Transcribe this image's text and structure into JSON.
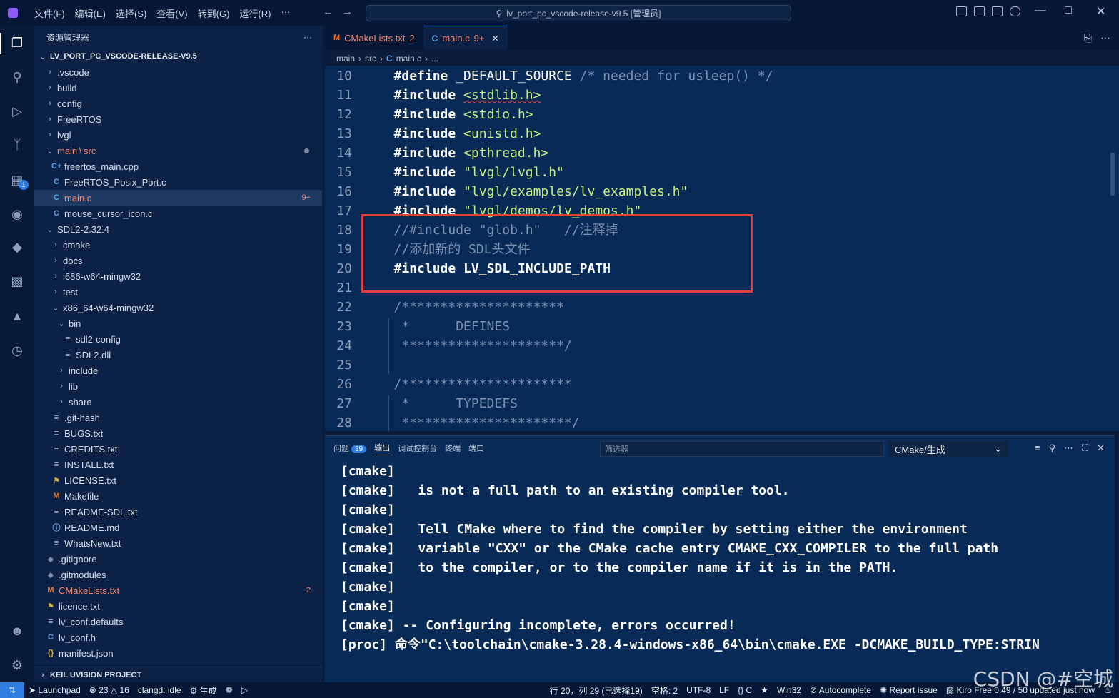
{
  "titlebar": {
    "menu": [
      "文件(F)",
      "编辑(E)",
      "选择(S)",
      "查看(V)",
      "转到(G)",
      "运行(R)",
      "···"
    ],
    "search": "lv_port_pc_vscode-release-v9.5 [管理员]"
  },
  "activity": {
    "extensions_badge": "1"
  },
  "sidebar": {
    "title": "资源管理器",
    "more": "···",
    "project": "LV_PORT_PC_VSCODE-RELEASE-V9.5",
    "items": [
      {
        "label": ".vscode",
        "type": "folder"
      },
      {
        "label": "build",
        "type": "folder"
      },
      {
        "label": "config",
        "type": "folder"
      },
      {
        "label": "FreeRTOS",
        "type": "folder"
      },
      {
        "label": "lvgl",
        "type": "folder"
      },
      {
        "label": "main",
        "label2": "src",
        "type": "folder-open"
      },
      {
        "label": "freertos_main.cpp",
        "icon": "C+"
      },
      {
        "label": "FreeRTOS_Posix_Port.c",
        "icon": "C"
      },
      {
        "label": "main.c",
        "icon": "C",
        "count": "9+"
      },
      {
        "label": "mouse_cursor_icon.c",
        "icon": "C"
      },
      {
        "label": "SDL2-2.32.4",
        "type": "folder-open"
      },
      {
        "label": "cmake",
        "type": "folder"
      },
      {
        "label": "docs",
        "type": "folder"
      },
      {
        "label": "i686-w64-mingw32",
        "type": "folder"
      },
      {
        "label": "test",
        "type": "folder"
      },
      {
        "label": "x86_64-w64-mingw32",
        "type": "folder-open"
      },
      {
        "label": "bin",
        "type": "folder-open"
      },
      {
        "label": "sdl2-config",
        "icon": "≡"
      },
      {
        "label": "SDL2.dll",
        "icon": "≡"
      },
      {
        "label": "include",
        "type": "folder"
      },
      {
        "label": "lib",
        "type": "folder"
      },
      {
        "label": "share",
        "type": "folder"
      },
      {
        "label": ".git-hash",
        "icon": "≡"
      },
      {
        "label": "BUGS.txt",
        "icon": "≡"
      },
      {
        "label": "CREDITS.txt",
        "icon": "≡"
      },
      {
        "label": "INSTALL.txt",
        "icon": "≡"
      },
      {
        "label": "LICENSE.txt",
        "icon": "🎗"
      },
      {
        "label": "Makefile",
        "icon": "M"
      },
      {
        "label": "README-SDL.txt",
        "icon": "≡"
      },
      {
        "label": "README.md",
        "icon": "ⓘ"
      },
      {
        "label": "WhatsNew.txt",
        "icon": "≡"
      },
      {
        "label": ".gitignore",
        "icon": "◆"
      },
      {
        "label": ".gitmodules",
        "icon": "◆"
      },
      {
        "label": "CMakeLists.txt",
        "icon": "M",
        "count": "2"
      },
      {
        "label": "licence.txt",
        "icon": "🎗"
      },
      {
        "label": "lv_conf.defaults",
        "icon": "≡"
      },
      {
        "label": "lv_conf.h",
        "icon": "C"
      },
      {
        "label": "manifest.json",
        "icon": "{}"
      }
    ],
    "bottom_section": "KEIL UVISION PROJECT"
  },
  "tabs": [
    {
      "icon": "M",
      "label": "CMakeLists.txt",
      "count": "2"
    },
    {
      "icon": "C",
      "label": "main.c",
      "count": "9+",
      "close": "✕"
    }
  ],
  "breadcrumb": [
    "main",
    "src",
    "main.c",
    "..."
  ],
  "code": [
    {
      "n": "10",
      "parts": [
        [
          "kw",
          "#define"
        ],
        [
          "ident",
          " _DEFAULT_SOURCE "
        ],
        [
          "cmt",
          "/* needed for usleep() */"
        ]
      ]
    },
    {
      "n": "11",
      "parts": [
        [
          "kw",
          "#include "
        ],
        [
          "str sq",
          "<stdlib.h>"
        ]
      ]
    },
    {
      "n": "12",
      "parts": [
        [
          "kw",
          "#include "
        ],
        [
          "str",
          "<stdio.h>"
        ]
      ]
    },
    {
      "n": "13",
      "parts": [
        [
          "kw",
          "#include "
        ],
        [
          "str",
          "<unistd.h>"
        ]
      ]
    },
    {
      "n": "14",
      "parts": [
        [
          "kw",
          "#include "
        ],
        [
          "str",
          "<pthread.h>"
        ]
      ]
    },
    {
      "n": "15",
      "parts": [
        [
          "kw",
          "#include "
        ],
        [
          "str",
          "\"lvgl/lvgl.h\""
        ]
      ]
    },
    {
      "n": "16",
      "parts": [
        [
          "kw",
          "#include "
        ],
        [
          "str",
          "\"lvgl/examples/lv_examples.h\""
        ]
      ]
    },
    {
      "n": "17",
      "parts": [
        [
          "kw",
          "#include "
        ],
        [
          "str",
          "\"lvgl/demos/lv_demos.h\""
        ]
      ]
    },
    {
      "n": "18",
      "parts": [
        [
          "cmt",
          "//#include \"glob.h\"   //注释掉"
        ]
      ]
    },
    {
      "n": "19",
      "parts": [
        [
          "cmt",
          "//添加新的 SDL头文件"
        ]
      ]
    },
    {
      "n": "20",
      "parts": [
        [
          "kw",
          "#include "
        ],
        [
          "kw",
          "LV_SDL_INCLUDE_PATH"
        ]
      ]
    },
    {
      "n": "21",
      "parts": []
    },
    {
      "n": "22",
      "parts": [
        [
          "cmt",
          "/*********************"
        ]
      ]
    },
    {
      "n": "23",
      "parts": [
        [
          "cmt",
          " *      DEFINES"
        ]
      ]
    },
    {
      "n": "24",
      "parts": [
        [
          "cmt",
          " *********************/"
        ]
      ]
    },
    {
      "n": "25",
      "parts": []
    },
    {
      "n": "26",
      "parts": [
        [
          "cmt",
          "/**********************"
        ]
      ]
    },
    {
      "n": "27",
      "parts": [
        [
          "cmt",
          " *      TYPEDEFS"
        ]
      ]
    },
    {
      "n": "28",
      "parts": [
        [
          "cmt",
          " **********************/"
        ]
      ]
    }
  ],
  "panel": {
    "tabs": [
      "问题",
      "输出",
      "调试控制台",
      "终端",
      "端口"
    ],
    "problems_count": "39",
    "filter_placeholder": "筛选器",
    "output_channel": "CMake/生成",
    "lines": [
      "[cmake]",
      "[cmake]   is not a full path to an existing compiler tool.",
      "[cmake]",
      "[cmake]   Tell CMake where to find the compiler by setting either the environment",
      "[cmake]   variable \"CXX\" or the CMake cache entry CMAKE_CXX_COMPILER to the full path",
      "[cmake]   to the compiler, or to the compiler name if it is in the PATH.",
      "[cmake]",
      "[cmake]",
      "[cmake] -- Configuring incomplete, errors occurred!",
      "[proc] 命令\"C:\\toolchain\\cmake-3.28.4-windows-x86_64\\bin\\cmake.EXE -DCMAKE_BUILD_TYPE:STRIN"
    ]
  },
  "status": {
    "launchpad": "Launchpad",
    "errors": "23",
    "warnings": "16",
    "clangd": "clangd: idle",
    "build": "生成",
    "cursor": "行 20，列 29 (已选择19)",
    "spaces": "空格: 2",
    "encoding": "UTF-8",
    "eol": "LF",
    "lang": "C",
    "platform": "Win32",
    "autocomplete": "Autocomplete",
    "report": "Report issue",
    "kiro": "Kiro Free 0.49 / 50 updated just now"
  },
  "watermark": "CSDN @#空城"
}
